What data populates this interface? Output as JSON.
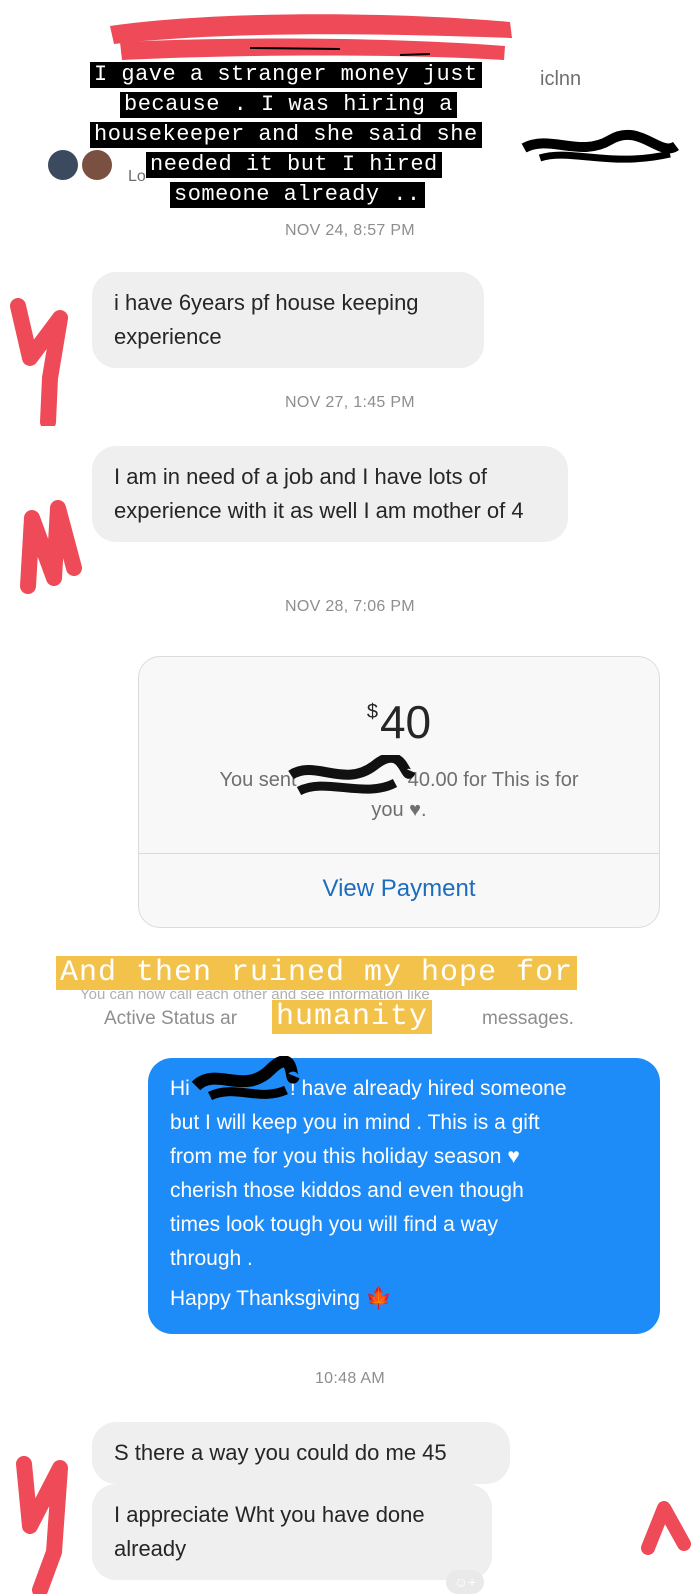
{
  "overlay_caption": {
    "lines": [
      "I gave a stranger money just",
      "because . I was hiring a",
      "housekeeper and she said she",
      "needed it but I hired",
      "someone already .."
    ]
  },
  "header": {
    "name_partial": "iclnn",
    "sub_partial": "Lo"
  },
  "conversation": {
    "ts1": "NOV 24, 8:57 PM",
    "msg1": "i have 6years pf house keeping experience",
    "ts2": "NOV 27, 1:45 PM",
    "msg2": "I am in need of a job and I have lots of experience with it as well I am mother of 4",
    "ts3": "NOV 28, 7:06 PM",
    "payment": {
      "currency": "$",
      "amount": "40",
      "note_prefix": "You sent",
      "note_suffix": "40.00 for This is for",
      "note_line2": "you ♥.",
      "view_label": "View Payment"
    },
    "yellow_caption": {
      "line1": "And then ruined my hope for",
      "line2": "humanity"
    },
    "info_partial_obscured": "You can now call each other and see information like",
    "info_left": "Active Status ar",
    "info_right": "messages.",
    "sent_message": {
      "line1_prefix": "Hi",
      "line1_suffix": "! have already hired someone",
      "line2": "but I will keep you in mind . This is a gift",
      "line3": "from me for you this holiday season ♥",
      "line4": "cherish those kiddos and even though",
      "line5": "times look tough you will find a way",
      "line6": "through .",
      "line7": "Happy Thanksgiving 🍁"
    },
    "ts4": "10:48 AM",
    "msg3": "S there a way you could do me 45",
    "msg4": "I appreciate Wht you have done already",
    "reaction_icon_label": "☺+"
  },
  "colors": {
    "incoming_bubble": "#efefef",
    "outgoing_bubble": "#1d8cf8",
    "timestamp": "#8e8e8e",
    "redaction_red": "#e8505b",
    "caption_yellow": "#f3c24b"
  }
}
